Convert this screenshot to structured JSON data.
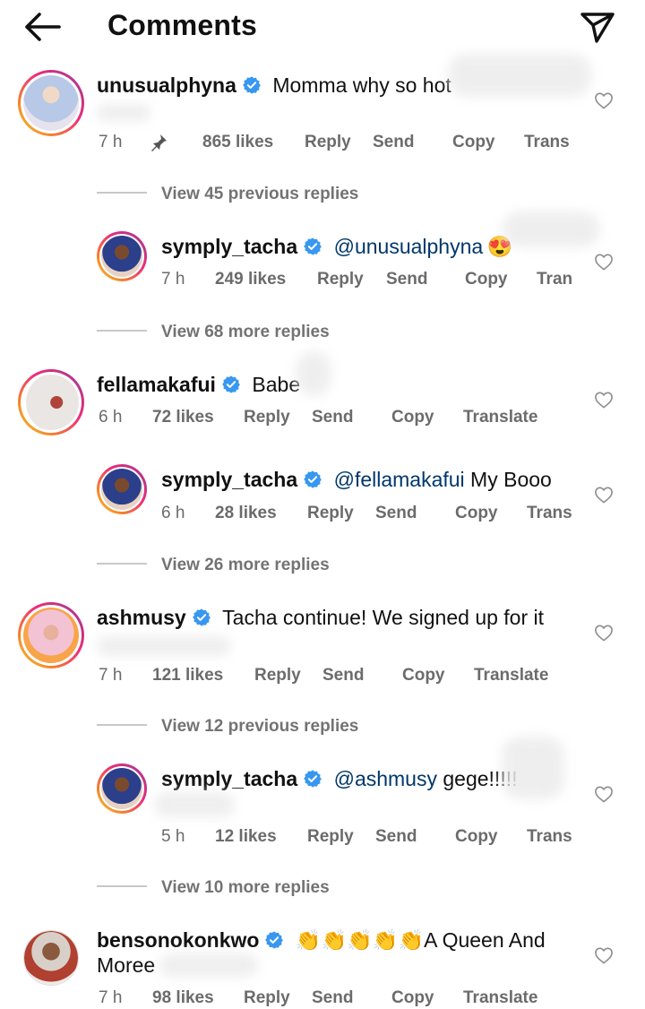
{
  "header": {
    "title": "Comments"
  },
  "icons": {
    "back": "arrow-left-icon",
    "share": "paper-plane-icon",
    "verified": "verified-badge-icon",
    "like": "heart-outline-icon",
    "pinned": "pin-icon"
  },
  "colors": {
    "verified": "#3897f0",
    "mention": "#00376b",
    "meta": "#6b6b6b"
  },
  "comments": [
    {
      "username": "unusualphyna",
      "text": "Momma why so hot",
      "time": "7 h",
      "likes": "865 likes",
      "reply": "Reply",
      "send": "Send",
      "copy": "Copy",
      "translate": "Trans",
      "view_replies": "View 45 previous replies"
    },
    {
      "username": "symply_tacha",
      "mention": "@unusualphyna",
      "emoji": "😍",
      "time": "7 h",
      "likes": "249 likes",
      "reply": "Reply",
      "send": "Send",
      "copy": "Copy",
      "translate": "Tran",
      "view_replies": "View 68 more replies"
    },
    {
      "username": "fellamakafui",
      "text": "Babe",
      "time": "6 h",
      "likes": "72 likes",
      "reply": "Reply",
      "send": "Send",
      "copy": "Copy",
      "translate": "Translate"
    },
    {
      "username": "symply_tacha",
      "mention": "@fellamakafui",
      "text": " My Booo",
      "time": "6 h",
      "likes": "28 likes",
      "reply": "Reply",
      "send": "Send",
      "copy": "Copy",
      "translate": "Trans",
      "view_replies": "View 26 more replies"
    },
    {
      "username": "ashmusy",
      "text": "Tacha continue! We signed up for it",
      "time": "7 h",
      "likes": "121 likes",
      "reply": "Reply",
      "send": "Send",
      "copy": "Copy",
      "translate": "Translate",
      "view_replies": "View 12 previous replies"
    },
    {
      "username": "symply_tacha",
      "mention": "@ashmusy",
      "text": " gege!!!!!",
      "time": "5 h",
      "likes": "12 likes",
      "reply": "Reply",
      "send": "Send",
      "copy": "Copy",
      "translate": "Trans",
      "view_replies": "View 10 more replies"
    },
    {
      "username": "bensonokonkwo",
      "emoji": "👏👏👏👏👏",
      "text": "A Queen And",
      "text2": "Moree",
      "time": "7 h",
      "likes": "98 likes",
      "reply": "Reply",
      "send": "Send",
      "copy": "Copy",
      "translate": "Translate"
    }
  ]
}
